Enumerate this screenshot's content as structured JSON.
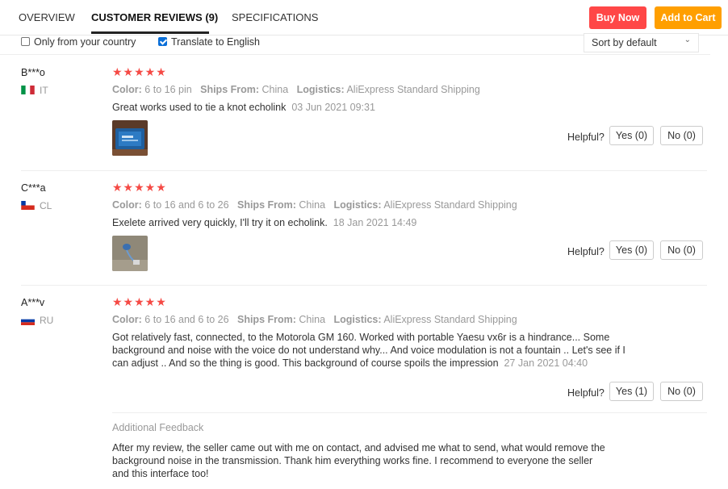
{
  "tabs": {
    "overview": "OVERVIEW",
    "reviews": "CUSTOMER REVIEWS (9)",
    "specs": "SPECIFICATIONS"
  },
  "actions": {
    "buy_now": "Buy Now",
    "add_to_cart": "Add to Cart"
  },
  "filters": {
    "only_country": "Only from your country",
    "only_country_checked": false,
    "translate": "Translate to English",
    "translate_checked": true,
    "sort_value": "Sort by default"
  },
  "labels": {
    "color": "Color:",
    "ships_from": "Ships From:",
    "logistics": "Logistics:",
    "helpful": "Helpful?",
    "additional_feedback": "Additional Feedback"
  },
  "reviews": [
    {
      "name": "B***o",
      "country": "IT",
      "stars": "★★★★★",
      "color": "6 to 16 pin",
      "ships_from": "China",
      "logistics": "AliExpress Standard Shipping",
      "text": "Great works used to tie a knot echolink",
      "date": "03 Jun 2021 09:31",
      "yes": "Yes (0)",
      "no": "No (0)"
    },
    {
      "name": "C***a",
      "country": "CL",
      "stars": "★★★★★",
      "color": "6 to 16 and 6 to 26",
      "ships_from": "China",
      "logistics": "AliExpress Standard Shipping",
      "text": "Exelete arrived very quickly, I'll try it on echolink.",
      "date": "18 Jan 2021 14:49",
      "yes": "Yes (0)",
      "no": "No (0)"
    },
    {
      "name": "A***v",
      "country": "RU",
      "stars": "★★★★★",
      "color": "6 to 16 and 6 to 26",
      "ships_from": "China",
      "logistics": "AliExpress Standard Shipping",
      "text_line1": "Got relatively fast, connected, to the Motorola GM 160. Worked with portable Yaesu vx6r is a hindrance... Some",
      "text_line2": "background and noise with the voice do not understand why... And voice modulation is not a fountain .. Let's see if I",
      "text_line3": "can adjust .. And so the thing is good. This background of course spoils the impression",
      "date": "27 Jan 2021 04:40",
      "yes": "Yes (1)",
      "no": "No (0)",
      "additional_line1": "After my review, the seller came out with me on contact, and advised me what to send, what would remove the",
      "additional_line2": "background noise in the transmission. Thank him everything works fine. I recommend to everyone the seller",
      "additional_line3": "and this interface too!"
    }
  ]
}
